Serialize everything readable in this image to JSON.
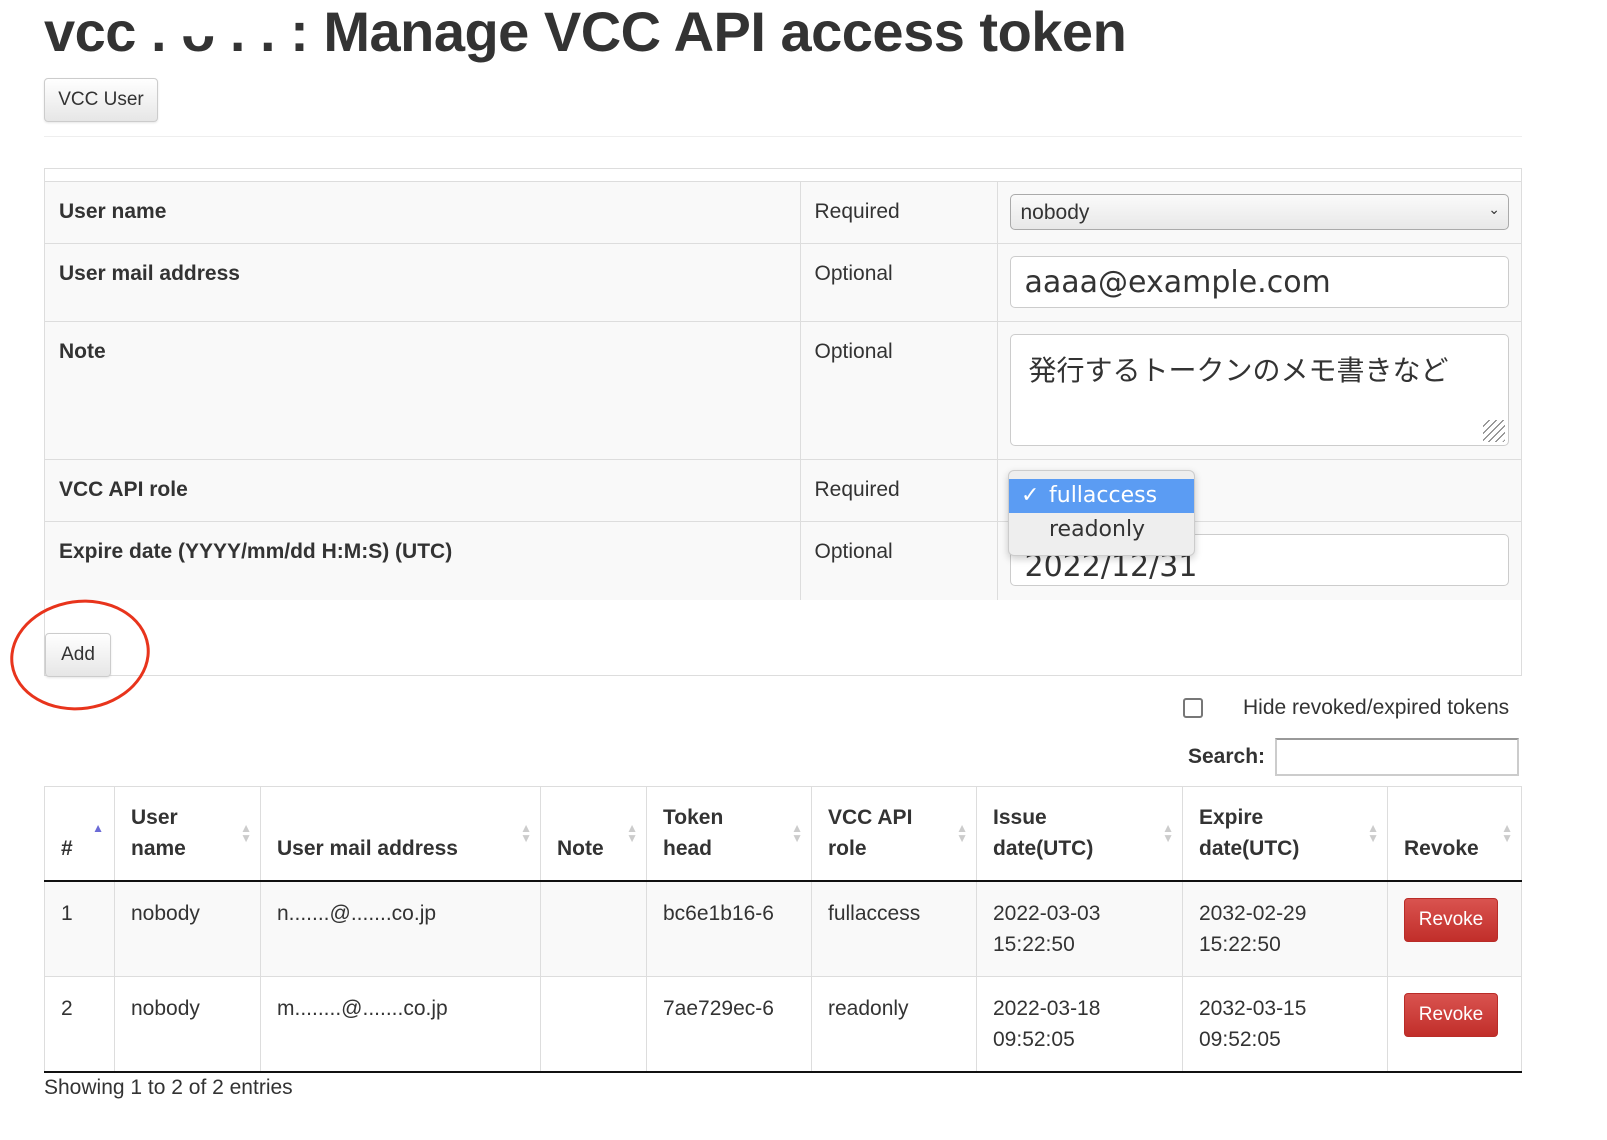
{
  "title": "vcc . ᴗ . . : Manage VCC API access token",
  "nav": {
    "vcc_user": "VCC User"
  },
  "form": {
    "rows": [
      {
        "label": "User name",
        "req": "Required"
      },
      {
        "label": "User mail address",
        "req": "Optional"
      },
      {
        "label": "Note",
        "req": "Optional"
      },
      {
        "label": "VCC API role",
        "req": "Required"
      },
      {
        "label": "Expire date (YYYY/mm/dd H:M:S) (UTC)",
        "req": "Optional"
      }
    ],
    "user_name": "nobody",
    "mail": "aaaa@example.com",
    "note": "発行するトークンのメモ書きなど",
    "expire": "2022/12/31",
    "role_options": [
      "fullaccess",
      "readonly"
    ],
    "role_selected": "fullaccess",
    "add": "Add"
  },
  "filter": {
    "hide_label": "Hide revoked/expired tokens",
    "search_label": "Search:"
  },
  "table": {
    "headers": [
      "#",
      "User name",
      "User mail address",
      "Note",
      "Token head",
      "VCC API role",
      "Issue date(UTC)",
      "Expire date(UTC)",
      "Revoke"
    ],
    "rows": [
      {
        "n": "1",
        "user": "nobody",
        "mail": "n.......@.......co.jp",
        "note": "",
        "token": "bc6e1b16-6",
        "role": "fullaccess",
        "issue1": "2022-03-03",
        "issue2": "15:22:50",
        "exp1": "2032-02-29",
        "exp2": "15:22:50",
        "revoke": "Revoke"
      },
      {
        "n": "2",
        "user": "nobody",
        "mail": "m........@.......co.jp",
        "note": "",
        "token": "7ae729ec-6",
        "role": "readonly",
        "issue1": "2022-03-18",
        "issue2": "09:52:05",
        "exp1": "2032-03-15",
        "exp2": "09:52:05",
        "revoke": "Revoke"
      }
    ]
  },
  "footer": {
    "info": "Showing 1 to 2 of 2 entries"
  },
  "colors": {
    "revoke": "#d9534f",
    "highlight": "#5b9cf3",
    "annotation": "#e8341c"
  }
}
